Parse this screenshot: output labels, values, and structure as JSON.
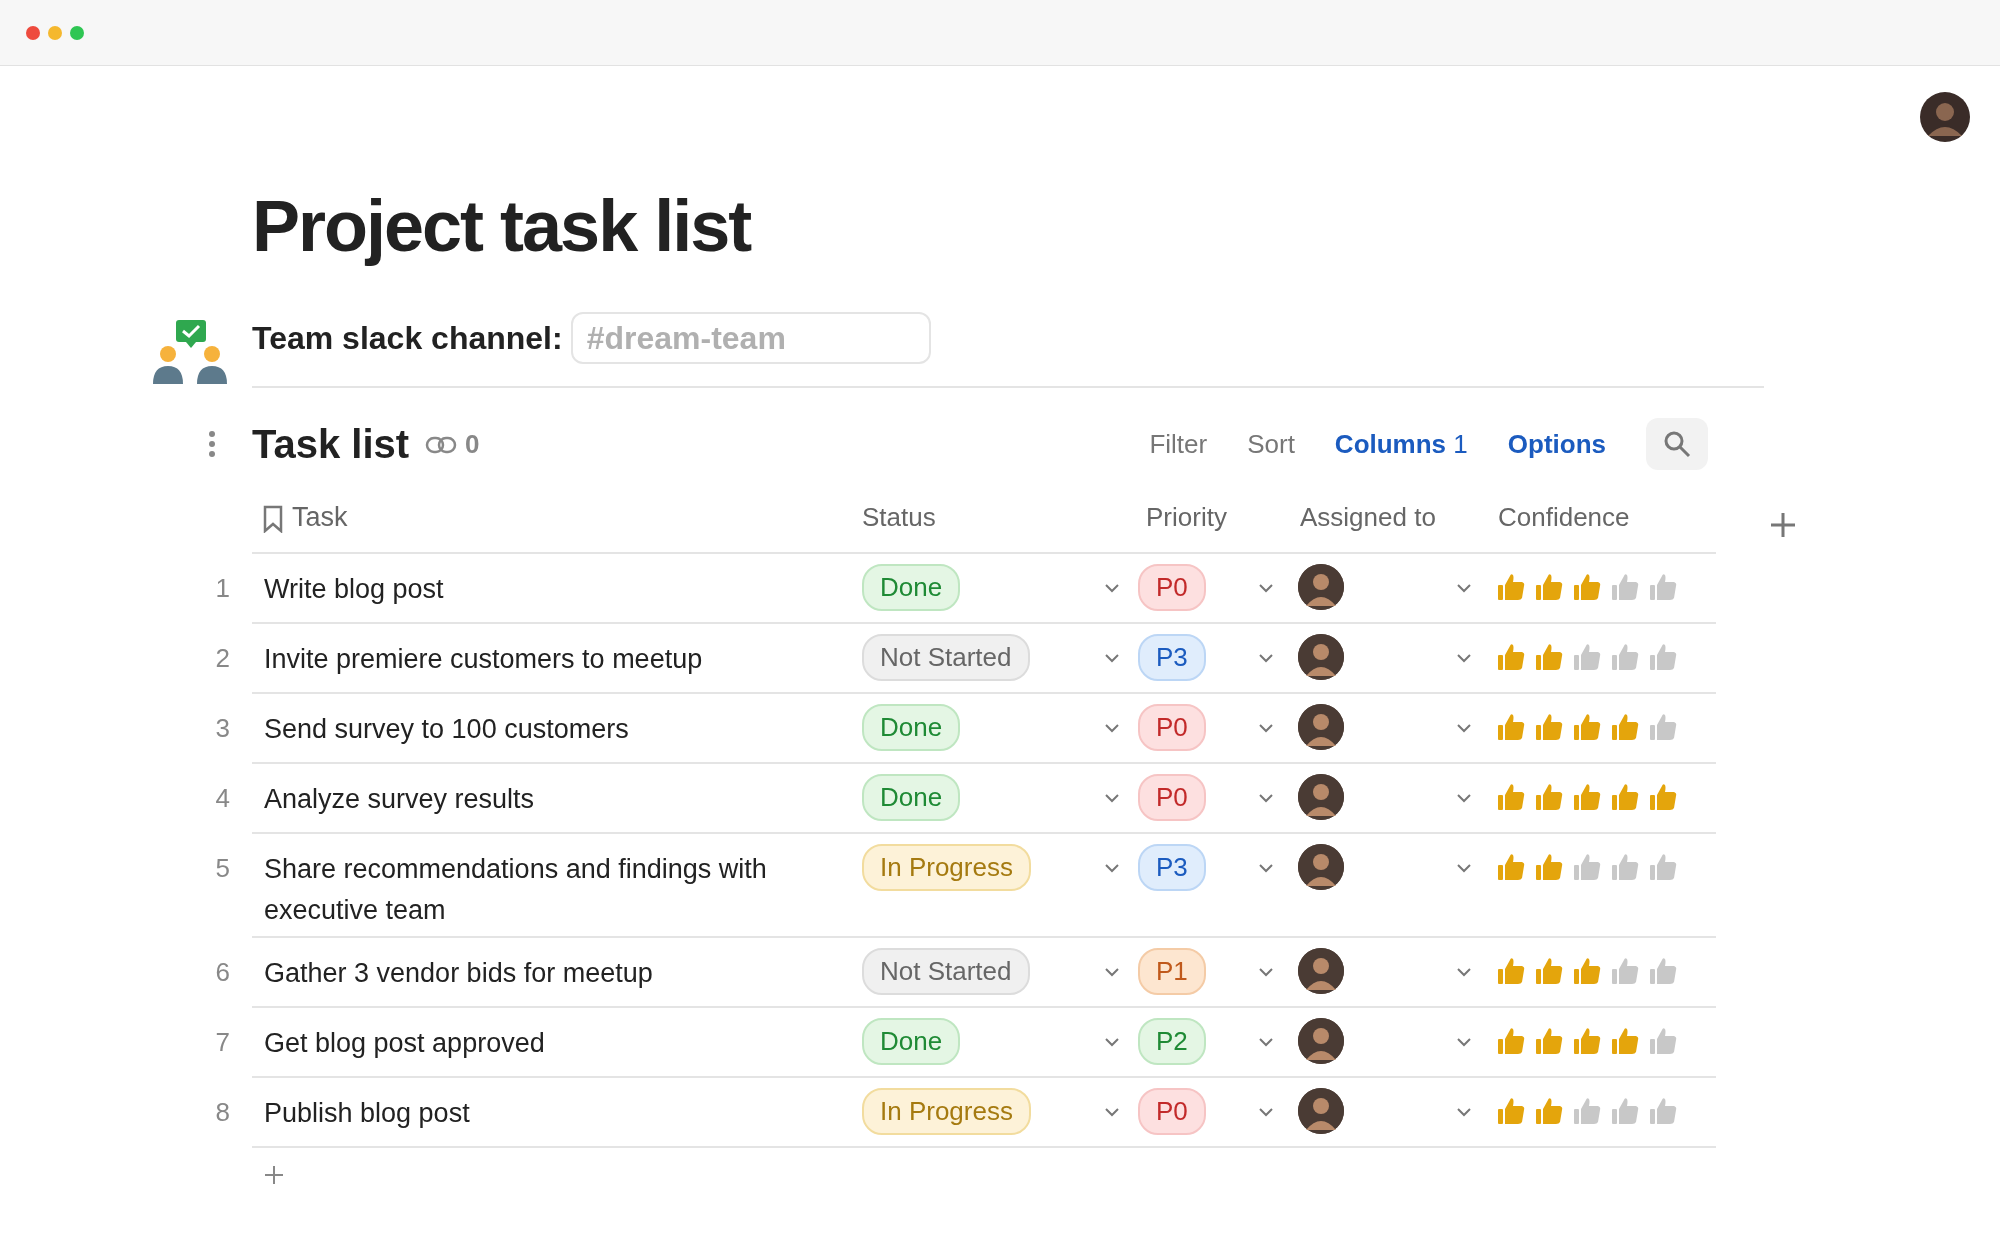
{
  "page": {
    "title": "Project task list",
    "slack_label": "Team slack channel:",
    "slack_placeholder": "#dream-team"
  },
  "section": {
    "title": "Task list",
    "link_count": "0",
    "actions": [
      {
        "label": "Filter",
        "active": false
      },
      {
        "label": "Sort",
        "active": false
      },
      {
        "label": "Columns",
        "count": "1",
        "active": true
      },
      {
        "label": "Options",
        "active": true
      }
    ]
  },
  "table": {
    "columns": [
      "Task",
      "Status",
      "Priority",
      "Assigned to",
      "Confidence"
    ],
    "rows": [
      {
        "number": "1",
        "task": "Write blog post",
        "status": {
          "label": "Done",
          "kind": "done"
        },
        "priority": {
          "label": "P0",
          "kind": "p0"
        },
        "stars": 3
      },
      {
        "number": "2",
        "task": "Invite premiere customers to meetup",
        "status": {
          "label": "Not Started",
          "kind": "not_started"
        },
        "priority": {
          "label": "P3",
          "kind": "p3"
        },
        "stars": 2
      },
      {
        "number": "3",
        "task": "Send survey to 100 customers",
        "status": {
          "label": "Done",
          "kind": "done"
        },
        "priority": {
          "label": "P0",
          "kind": "p0"
        },
        "stars": 4
      },
      {
        "number": "4",
        "task": "Analyze survey results",
        "status": {
          "label": "Done",
          "kind": "done"
        },
        "priority": {
          "label": "P0",
          "kind": "p0"
        },
        "stars": 5
      },
      {
        "number": "5",
        "task": "Share recommendations and findings with executive team",
        "status": {
          "label": "In Progress",
          "kind": "in_progress"
        },
        "priority": {
          "label": "P3",
          "kind": "p3"
        },
        "stars": 2
      },
      {
        "number": "6",
        "task": "Gather 3 vendor bids for meetup",
        "status": {
          "label": "Not Started",
          "kind": "not_started"
        },
        "priority": {
          "label": "P1",
          "kind": "p1"
        },
        "stars": 3
      },
      {
        "number": "7",
        "task": "Get blog post approved",
        "status": {
          "label": "Done",
          "kind": "done"
        },
        "priority": {
          "label": "P2",
          "kind": "p2"
        },
        "stars": 4
      },
      {
        "number": "8",
        "task": "Publish blog post",
        "status": {
          "label": "In Progress",
          "kind": "in_progress"
        },
        "priority": {
          "label": "P0",
          "kind": "p0"
        },
        "stars": 2
      }
    ]
  }
}
